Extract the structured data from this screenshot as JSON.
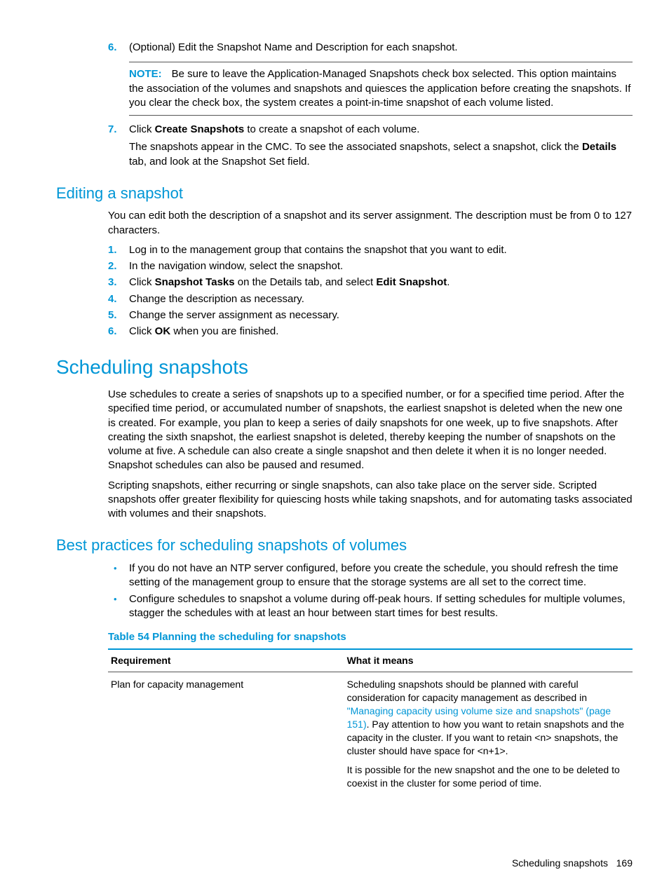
{
  "step6": {
    "num": "6.",
    "text": "(Optional) Edit the Snapshot Name and Description for each snapshot."
  },
  "note": {
    "label": "NOTE:",
    "text": "Be sure to leave the Application-Managed Snapshots check box selected. This option maintains the association of the volumes and snapshots and quiesces the application before creating the snapshots. If you clear the check box, the system creates a point-in-time snapshot of each volume listed."
  },
  "step7": {
    "num": "7.",
    "pre": "Click ",
    "bold": "Create Snapshots",
    "post": " to create a snapshot of each volume.",
    "sub_pre": "The snapshots appear in the CMC. To see the associated snapshots, select a snapshot, click the ",
    "sub_bold": "Details",
    "sub_post": " tab, and look at the Snapshot Set field."
  },
  "editing": {
    "heading": "Editing a snapshot",
    "intro": "You can edit both the description of a snapshot and its server assignment. The description must be from 0 to 127 characters.",
    "steps": {
      "n1": "1.",
      "t1": "Log in to the management group that contains the snapshot that you want to edit.",
      "n2": "2.",
      "t2": "In the navigation window, select the snapshot.",
      "n3": "3.",
      "t3_pre": "Click ",
      "t3_b1": "Snapshot Tasks",
      "t3_mid": " on the Details tab, and select ",
      "t3_b2": "Edit Snapshot",
      "t3_post": ".",
      "n4": "4.",
      "t4": "Change the description as necessary.",
      "n5": "5.",
      "t5": "Change the server assignment as necessary.",
      "n6": "6.",
      "t6_pre": "Click ",
      "t6_b": "OK",
      "t6_post": " when you are finished."
    }
  },
  "scheduling": {
    "heading": "Scheduling snapshots",
    "p1": "Use schedules to create a series of snapshots up to a specified number, or for a specified time period. After the specified time period, or accumulated number of snapshots, the earliest snapshot is deleted when the new one is created. For example, you plan to keep a series of daily snapshots for one week, up to five snapshots. After creating the sixth snapshot, the earliest snapshot is deleted, thereby keeping the number of snapshots on the volume at five. A schedule can also create a single snapshot and then delete it when it is no longer needed. Snapshot schedules can also be paused and resumed.",
    "p2": "Scripting snapshots, either recurring or single snapshots, can also take place on the server side. Scripted snapshots offer greater flexibility for quiescing hosts while taking snapshots, and for automating tasks associated with volumes and their snapshots."
  },
  "best": {
    "heading": "Best practices for scheduling snapshots of volumes",
    "b1": "If you do not have an NTP server configured, before you create the schedule, you should refresh the time setting of the management group to ensure that the storage systems are all set to the correct time.",
    "b2": "Configure schedules to snapshot a volume during off-peak hours. If setting schedules for multiple volumes, stagger the schedules with at least an hour between start times for best results."
  },
  "table": {
    "caption": "Table 54 Planning the scheduling for snapshots",
    "h1": "Requirement",
    "h2": "What it means",
    "r1c1": "Plan for capacity management",
    "r1c2_pre": "Scheduling snapshots should be planned with careful consideration for capacity management as described in ",
    "r1c2_link": "\"Managing capacity using volume size and snapshots\" (page 151)",
    "r1c2_post": ". Pay attention to how you want to retain snapshots and the capacity in the cluster. If you want to retain <n> snapshots, the cluster should have space for <n+1>.",
    "r1c2_p2": "It is possible for the new snapshot and the one to be deleted to coexist in the cluster for some period of time."
  },
  "footer": {
    "text": "Scheduling snapshots",
    "page": "169"
  }
}
